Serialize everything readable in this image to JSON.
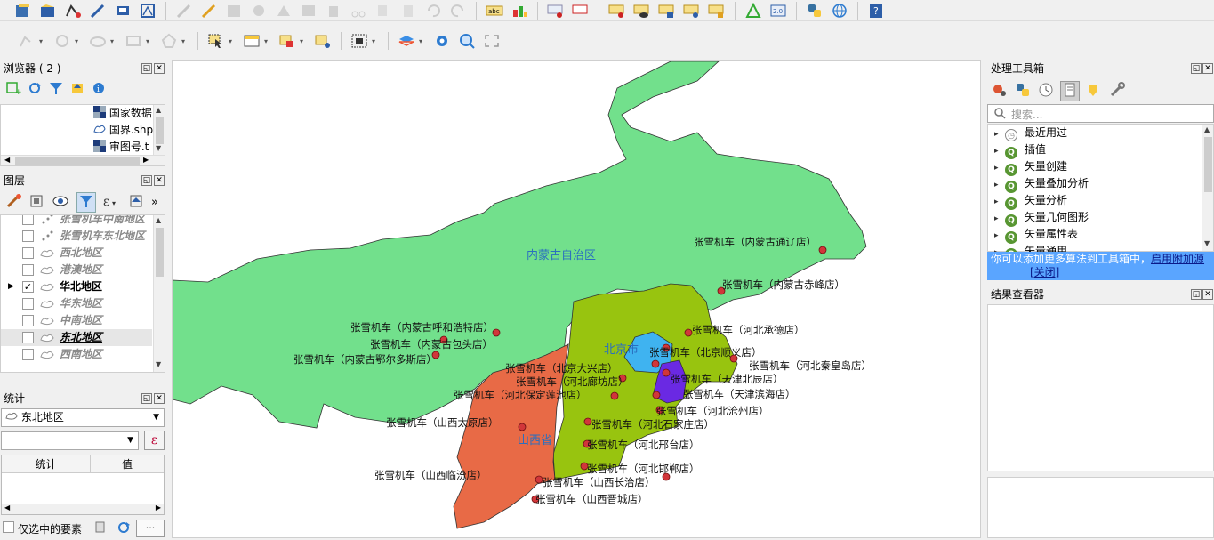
{
  "toolbar": {
    "row1_icons": [
      "new-project-icon",
      "open-project-icon",
      "digitize-icon",
      "edit-pencil-icon",
      "save-layer-icon",
      "vertex-tool-icon",
      "add-feature-icon",
      "pencil-icon",
      "save-edits-icon",
      "undo-icon",
      "redo-icon",
      "label-abc-icon",
      "label-pin-icon",
      "label-move-icon",
      "label-rotate-icon",
      "label-change-icon",
      "label-show-icon",
      "python-icon",
      "globe-icon",
      "help-icon"
    ],
    "row2_icons": [
      "select-feature-icon",
      "select-expression-icon",
      "attribute-table-icon",
      "deselect-icon",
      "select-location-icon",
      "layer-style-icon",
      "settings-gear-icon",
      "zoom-magnifier-icon",
      "fullscreen-icon"
    ]
  },
  "browser": {
    "title": "浏览器 ( 2 )",
    "items": [
      {
        "label": "国家数据",
        "icon": "raster-icon"
      },
      {
        "label": "国界.shp",
        "icon": "polygon-layer-icon"
      },
      {
        "label": "审图号.t",
        "icon": "raster-icon"
      }
    ]
  },
  "layers": {
    "title": "图层",
    "items": [
      {
        "label": "张雪机车中南地区",
        "checked": false,
        "type": "point",
        "active": false
      },
      {
        "label": "张雪机车东北地区",
        "checked": false,
        "type": "point",
        "active": false
      },
      {
        "label": "西北地区",
        "checked": false,
        "type": "polygon",
        "active": false
      },
      {
        "label": "港澳地区",
        "checked": false,
        "type": "polygon",
        "active": false
      },
      {
        "label": "华北地区",
        "checked": true,
        "type": "polygon",
        "active": true
      },
      {
        "label": "华东地区",
        "checked": false,
        "type": "polygon",
        "active": false
      },
      {
        "label": "中南地区",
        "checked": false,
        "type": "polygon",
        "active": false
      },
      {
        "label": "东北地区",
        "checked": false,
        "type": "polygon",
        "active": false
      },
      {
        "label": "西南地区",
        "checked": false,
        "type": "polygon",
        "active": false
      }
    ]
  },
  "statistics": {
    "title": "统计",
    "layer": "东北地区",
    "col_stat": "统计",
    "col_value": "值",
    "only_selected": "仅选中的要素",
    "expr_icon": "ε",
    "more": "···"
  },
  "toolbox": {
    "title": "处理工具箱",
    "search_placeholder": "搜索...",
    "algorithms": [
      "最近用过",
      "插值",
      "矢量创建",
      "矢量叠加分析",
      "矢量分析",
      "矢量几何图形",
      "矢量属性表",
      "矢量通用"
    ],
    "notice_text": "你可以添加更多算法到工具箱中，",
    "notice_link": "启用附加源",
    "notice_close": "[关闭]"
  },
  "results": {
    "title": "结果查看器"
  },
  "map": {
    "colors": {
      "inner_mongolia": "#72e08c",
      "hebei": "#98c40f",
      "shanxi": "#e86a46",
      "beijing": "#3fb3f0",
      "tianjin": "#6a29e3",
      "store_point": "#d1363a"
    },
    "regions": {
      "inner_mongolia": "内蒙古自治区",
      "beijing": "北京市",
      "shanxi": "山西省"
    },
    "stores": [
      "张雪机车（内蒙古通辽店）",
      "张雪机车（内蒙古赤峰店）",
      "张雪机车（内蒙古呼和浩特店）",
      "张雪机车（内蒙古包头店）",
      "张雪机车（内蒙古鄂尔多斯店）",
      "张雪机车（河北承德店）",
      "张雪机车（北京顺义店）",
      "张雪机车（河北秦皇岛店）",
      "张雪机车（北京大兴店）",
      "张雪机车（河北廊坊店）",
      "张雪机车（天津北辰店）",
      "张雪机车（河北保定莲池店）",
      "张雪机车（天津滨海店）",
      "张雪机车（河北沧州店）",
      "张雪机车（山西太原店）",
      "张雪机车（河北石家庄店）",
      "张雪机车（河北邢台店）",
      "张雪机车（河北邯郸店）",
      "张雪机车（山西临汾店）",
      "张雪机车（山西长治店）",
      "张雪机车（山西晋城店）"
    ]
  }
}
